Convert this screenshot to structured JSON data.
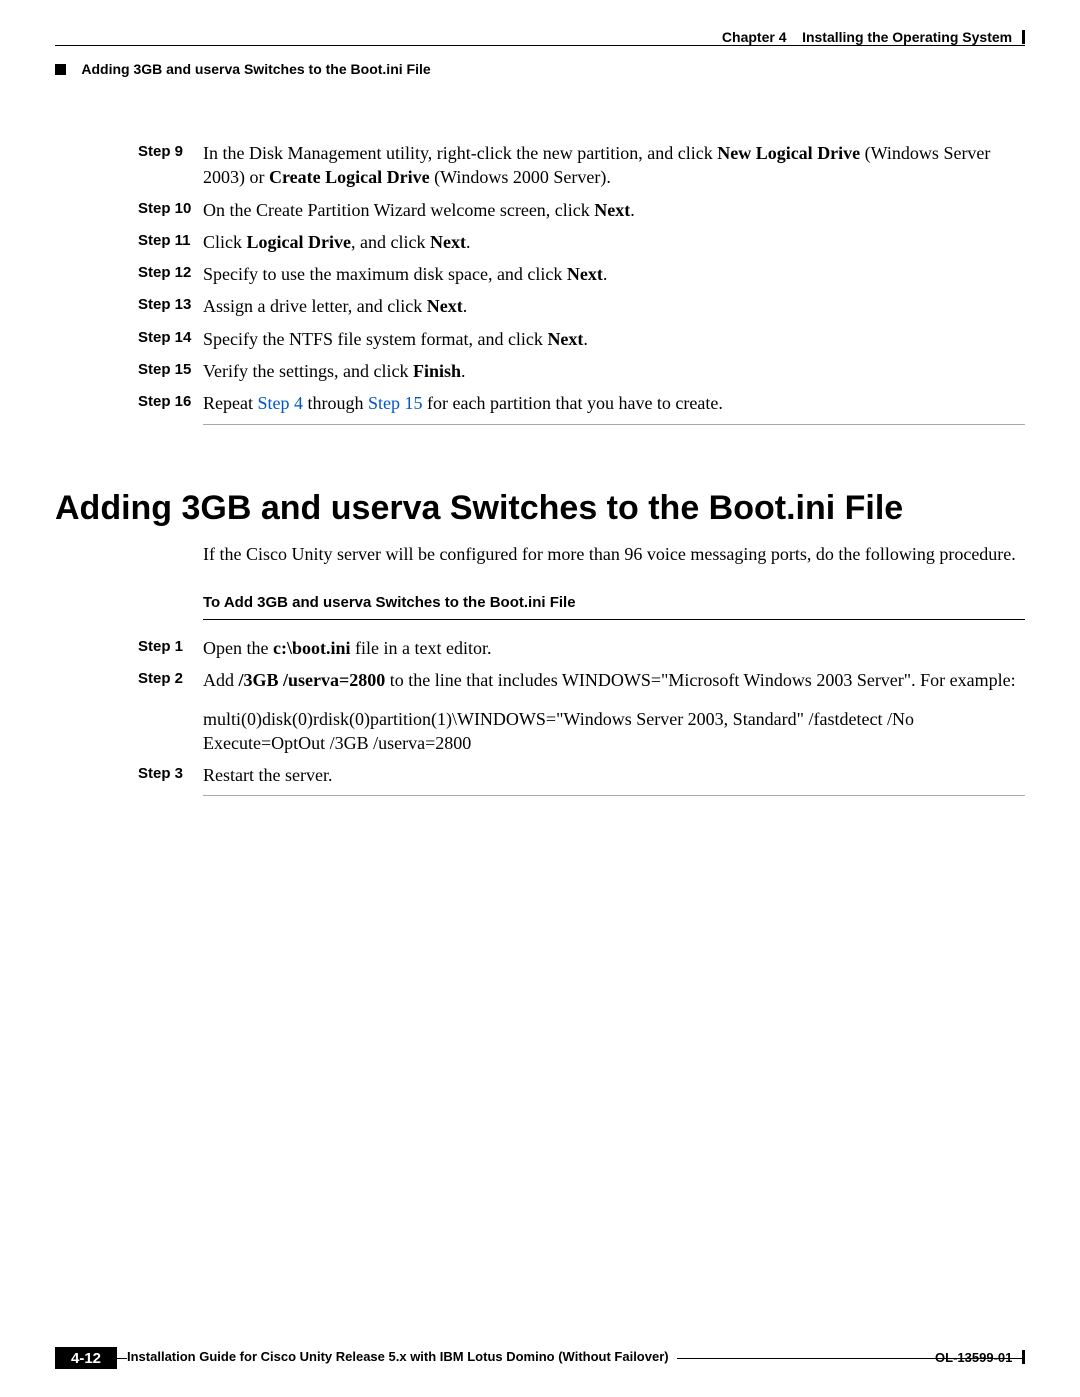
{
  "header": {
    "chapter_label": "Chapter 4",
    "chapter_title": "Installing the Operating System",
    "section_crumb": "Adding 3GB and userva Switches to the Boot.ini File"
  },
  "steps1": [
    {
      "n": "Step 9",
      "parts": [
        {
          "t": "In the Disk Management utility, right-click the new partition, and click "
        },
        {
          "t": "New Logical Drive",
          "b": true
        },
        {
          "t": " (Windows Server 2003) or "
        },
        {
          "t": "Create Logical Drive",
          "b": true
        },
        {
          "t": " (Windows 2000 Server)."
        }
      ]
    },
    {
      "n": "Step 10",
      "parts": [
        {
          "t": "On the Create Partition Wizard welcome screen, click "
        },
        {
          "t": "Next",
          "b": true
        },
        {
          "t": "."
        }
      ]
    },
    {
      "n": "Step 11",
      "parts": [
        {
          "t": "Click "
        },
        {
          "t": "Logical Drive",
          "b": true
        },
        {
          "t": ", and click "
        },
        {
          "t": "Next",
          "b": true
        },
        {
          "t": "."
        }
      ]
    },
    {
      "n": "Step 12",
      "parts": [
        {
          "t": "Specify to use the maximum disk space, and click "
        },
        {
          "t": "Next",
          "b": true
        },
        {
          "t": "."
        }
      ]
    },
    {
      "n": "Step 13",
      "parts": [
        {
          "t": "Assign a drive letter, and click "
        },
        {
          "t": "Next",
          "b": true
        },
        {
          "t": "."
        }
      ]
    },
    {
      "n": "Step 14",
      "parts": [
        {
          "t": "Specify the NTFS file system format, and click "
        },
        {
          "t": "Next",
          "b": true
        },
        {
          "t": "."
        }
      ]
    },
    {
      "n": "Step 15",
      "parts": [
        {
          "t": "Verify the settings, and click "
        },
        {
          "t": "Finish",
          "b": true
        },
        {
          "t": "."
        }
      ]
    },
    {
      "n": "Step 16",
      "parts": [
        {
          "t": "Repeat "
        },
        {
          "t": "Step 4",
          "link": true
        },
        {
          "t": " through "
        },
        {
          "t": "Step 15",
          "link": true
        },
        {
          "t": " for each partition that you have to create."
        }
      ]
    }
  ],
  "big_title": "Adding 3GB and userva Switches to the Boot.ini File",
  "intro": "If the Cisco Unity server will be configured for more than 96 voice messaging ports, do the following procedure.",
  "subhead": "To Add 3GB and userva Switches to the Boot.ini File",
  "steps2": [
    {
      "n": "Step 1",
      "parts": [
        {
          "t": "Open the "
        },
        {
          "t": "c:\\boot.ini",
          "b": true
        },
        {
          "t": " file in a text editor."
        }
      ]
    },
    {
      "n": "Step 2",
      "parts": [
        {
          "t": "Add "
        },
        {
          "t": "/3GB /userva=2800",
          "b": true
        },
        {
          "t": " to the line that includes WINDOWS=\"Microsoft Windows 2003 Server\". For example:"
        }
      ],
      "cont": "multi(0)disk(0)rdisk(0)partition(1)\\WINDOWS=\"Windows Server 2003, Standard\" /fastdetect /No Execute=OptOut /3GB /userva=2800"
    },
    {
      "n": "Step 3",
      "parts": [
        {
          "t": "Restart the server."
        }
      ]
    }
  ],
  "footer": {
    "doc_title": "Installation Guide for Cisco Unity Release 5.x with IBM Lotus Domino (Without Failover)",
    "page": "4-12",
    "doc_num": "OL-13599-01"
  }
}
